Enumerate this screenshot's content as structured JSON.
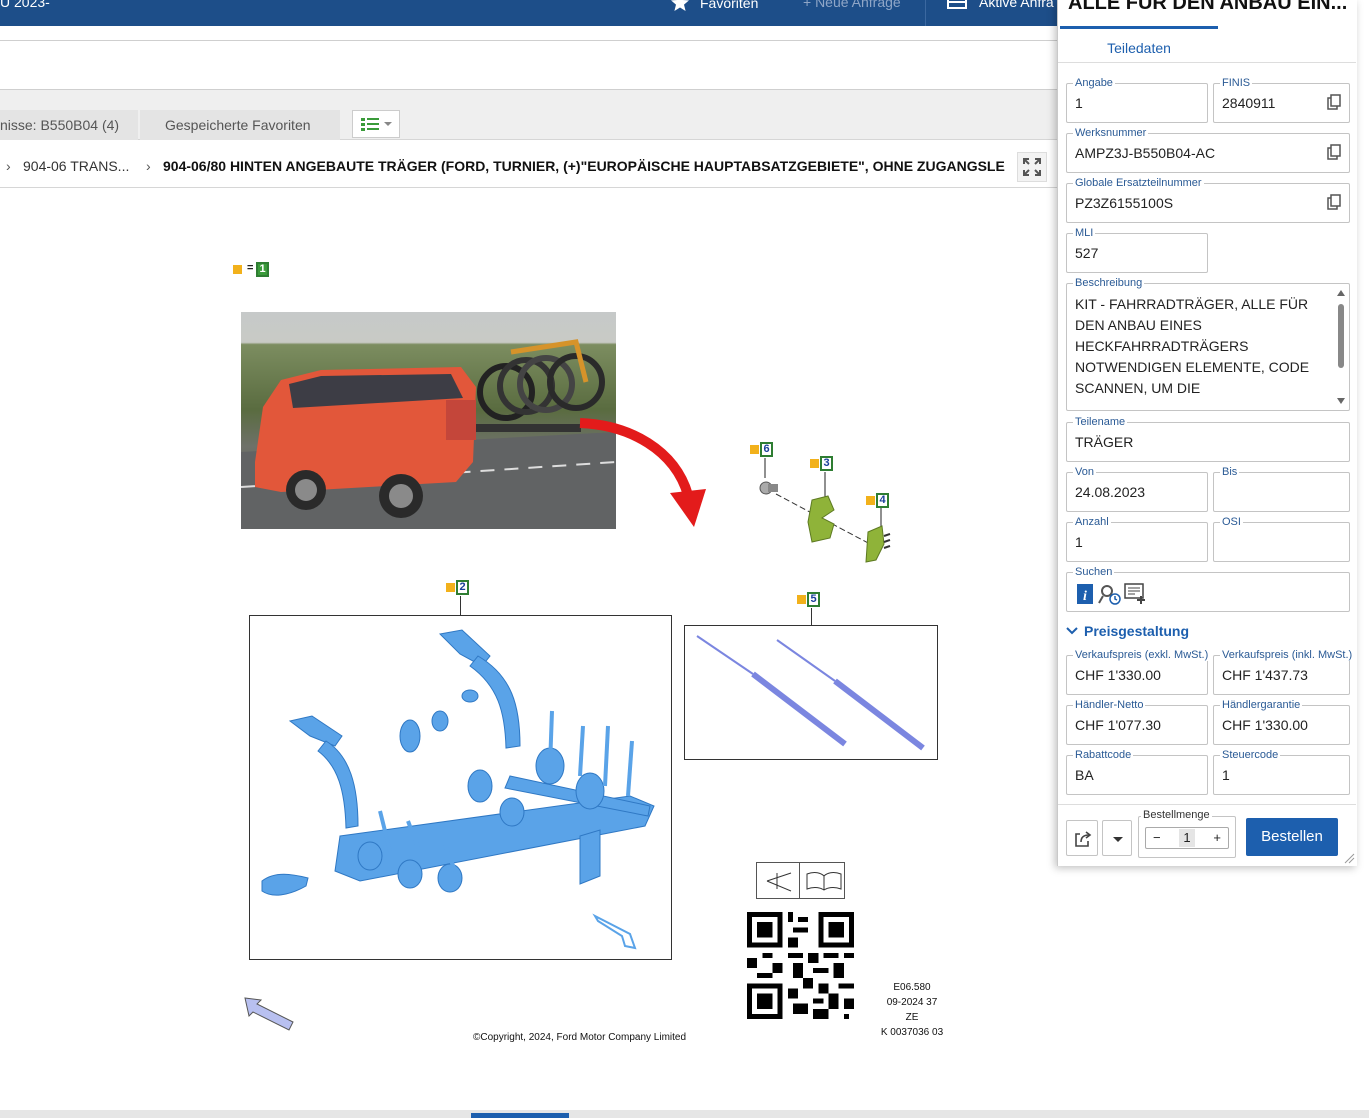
{
  "topbar": {
    "title_fragment": "U 2023-",
    "favorites": "Favoriten",
    "new_request": "+ Neue Anfrage",
    "active_requests": "Aktive Anfra"
  },
  "tabs": {
    "results": "nisse: B550B04 (4)",
    "saved_favorites": "Gespeicherte Favoriten"
  },
  "breadcrumb": {
    "level1": "904-06 TRANS...",
    "current": "904-06/80 HINTEN ANGEBAUTE TRÄGER (FORD, TURNIER, (+)\"EUROPÄISCHE HAUPTABSATZGEBIETE\", OHNE ZUGANGSLEI..."
  },
  "illustration": {
    "legend_eq": "=",
    "legend_num": "1",
    "callouts": [
      "2",
      "3",
      "4",
      "5",
      "6"
    ],
    "meta_lines": [
      "E06.580",
      "09-2024 37",
      "ZE",
      "K 0037036 03"
    ],
    "copyright": "©Copyright, 2024, Ford Motor Company Limited"
  },
  "panel": {
    "title": "ALLE FÜR DEN ANBAU EIN...",
    "tab": "Teiledaten",
    "fields": {
      "angabe": {
        "label": "Angabe",
        "value": "1"
      },
      "finis": {
        "label": "FINIS",
        "value": "2840911"
      },
      "werksnummer": {
        "label": "Werksnummer",
        "value": "AMPZ3J-B550B04-AC"
      },
      "global_part": {
        "label": "Globale Ersatzteilnummer",
        "value": "PZ3Z6155100S"
      },
      "mli": {
        "label": "MLI",
        "value": "527"
      },
      "beschreibung": {
        "label": "Beschreibung",
        "value": "KIT - FAHRRADTRÄGER, ALLE FÜR DEN ANBAU EINES HECKFAHRRADTRÄGERS NOTWENDIGEN ELEMENTE, CODE SCANNEN, UM DIE BAUGRUPPENANWEISUNGEN ZU ÖFFNEN. HERKÖMMLICHE"
      },
      "teilename": {
        "label": "Teilename",
        "value": "TRÄGER"
      },
      "von": {
        "label": "Von",
        "value": "24.08.2023"
      },
      "bis": {
        "label": "Bis",
        "value": ""
      },
      "anzahl": {
        "label": "Anzahl",
        "value": "1"
      },
      "osi": {
        "label": "OSI",
        "value": ""
      },
      "suchen": {
        "label": "Suchen"
      }
    },
    "pricing": {
      "heading": "Preisgestaltung",
      "vk_exkl": {
        "label": "Verkaufspreis (exkl. MwSt.)",
        "value": "CHF 1'330.00"
      },
      "vk_inkl": {
        "label": "Verkaufspreis (inkl. MwSt.)",
        "value": "CHF 1'437.73"
      },
      "haendler_netto": {
        "label": "Händler-Netto",
        "value": "CHF 1'077.30"
      },
      "haendlergarantie": {
        "label": "Händlergarantie",
        "value": "CHF 1'330.00"
      },
      "rabattcode": {
        "label": "Rabattcode",
        "value": "BA"
      },
      "steuercode": {
        "label": "Steuercode",
        "value": "1"
      }
    },
    "order": {
      "qty_label": "Bestellmenge",
      "qty_minus": "−",
      "qty_value": "1",
      "qty_plus": "+",
      "order_button": "Bestellen"
    }
  },
  "colors": {
    "brand_blue": "#1d4e89",
    "accent_blue": "#1d5fae",
    "part_blue": "#5aa3e8",
    "part_green": "#8fb339",
    "callout_yellow": "#f2b11b"
  }
}
